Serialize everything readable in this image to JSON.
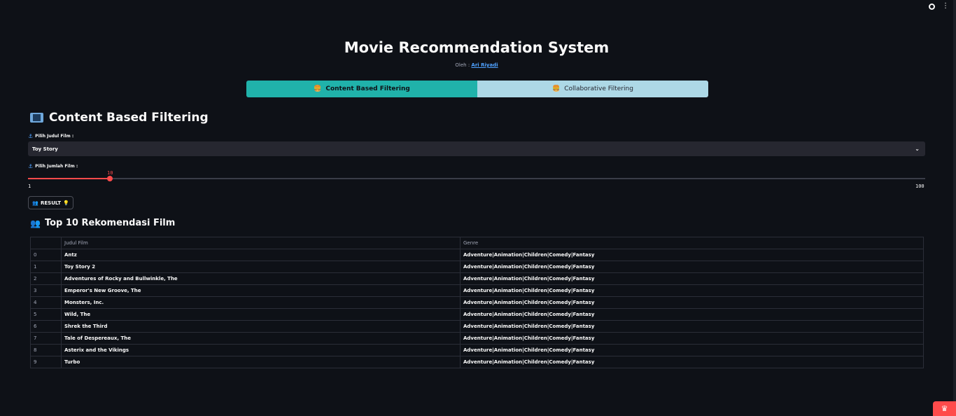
{
  "header": {
    "title": "Movie Recommendation System",
    "by_label": "Oleh : ",
    "author": "Ari Riyadi"
  },
  "tabs": [
    {
      "emoji": "🍔",
      "label": "Content Based Filtering",
      "active": true
    },
    {
      "emoji": "🍔",
      "label": "Collaborative Filtering",
      "active": false
    }
  ],
  "section": {
    "title": "Content Based Filtering",
    "select_label": "Pilih Judul Film :",
    "select_value": "Toy Story",
    "slider_label": "Pilih Jumlah Film :",
    "slider_value": "10",
    "slider_min": "1",
    "slider_max": "100",
    "slider_fraction": 0.0909,
    "button_label": "RESULT"
  },
  "results": {
    "title": "Top 10 Rekomendasi Film",
    "columns": [
      "",
      "Judul Film",
      "Genre"
    ],
    "rows": [
      [
        "0",
        "Antz",
        "Adventure|Animation|Children|Comedy|Fantasy"
      ],
      [
        "1",
        "Toy Story 2",
        "Adventure|Animation|Children|Comedy|Fantasy"
      ],
      [
        "2",
        "Adventures of Rocky and Bullwinkle, The",
        "Adventure|Animation|Children|Comedy|Fantasy"
      ],
      [
        "3",
        "Emperor's New Groove, The",
        "Adventure|Animation|Children|Comedy|Fantasy"
      ],
      [
        "4",
        "Monsters, Inc.",
        "Adventure|Animation|Children|Comedy|Fantasy"
      ],
      [
        "5",
        "Wild, The",
        "Adventure|Animation|Children|Comedy|Fantasy"
      ],
      [
        "6",
        "Shrek the Third",
        "Adventure|Animation|Children|Comedy|Fantasy"
      ],
      [
        "7",
        "Tale of Despereaux, The",
        "Adventure|Animation|Children|Comedy|Fantasy"
      ],
      [
        "8",
        "Asterix and the Vikings",
        "Adventure|Animation|Children|Comedy|Fantasy"
      ],
      [
        "9",
        "Turbo",
        "Adventure|Animation|Children|Comedy|Fantasy"
      ]
    ]
  },
  "colors": {
    "background": "#0e1117",
    "accent": "#ff4b4b",
    "tab_active": "#20b2aa",
    "tab_inactive": "#add8e6",
    "link": "#4ea1ff"
  }
}
